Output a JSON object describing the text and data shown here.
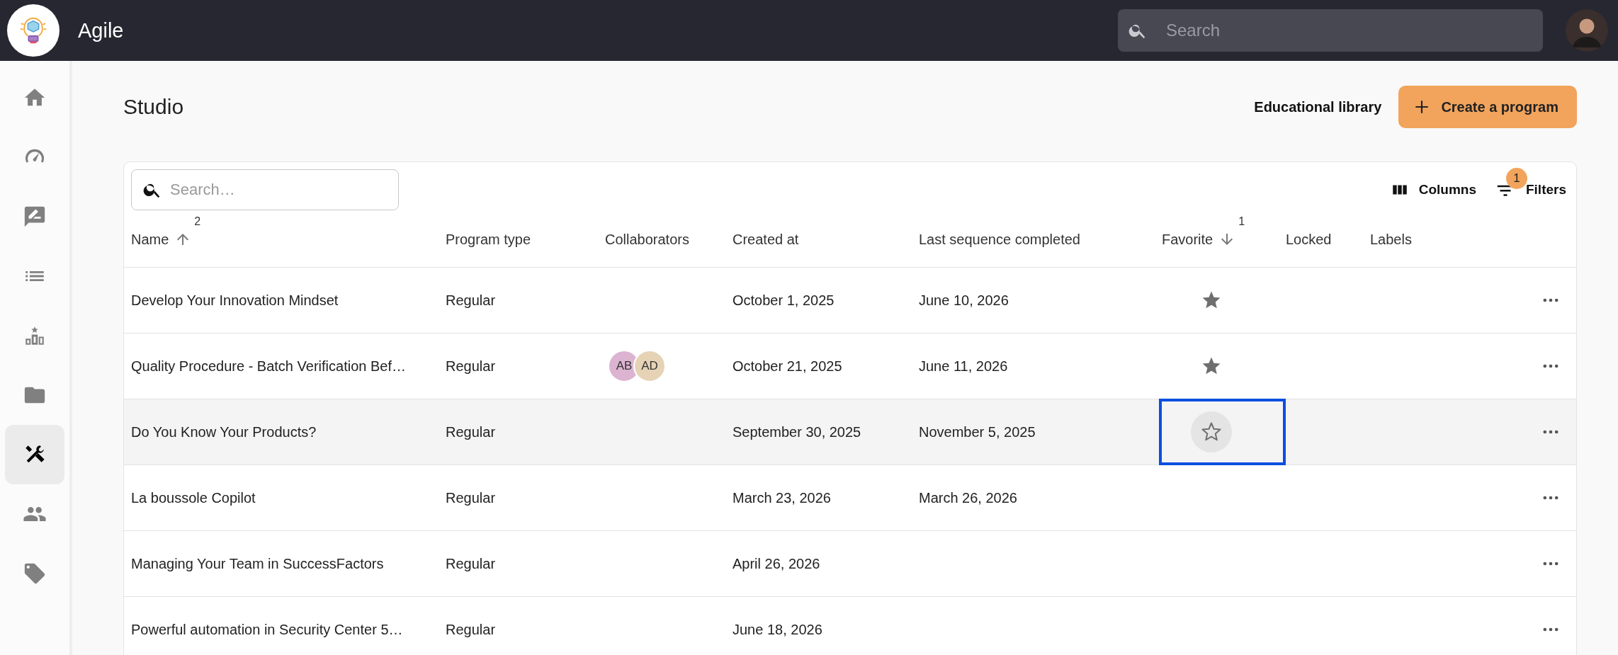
{
  "app": {
    "title": "Agile"
  },
  "top_search": {
    "placeholder": "Search"
  },
  "sidebar": {
    "items": [
      {
        "selected": false
      },
      {
        "selected": false
      },
      {
        "selected": false
      },
      {
        "selected": false
      },
      {
        "selected": false
      },
      {
        "selected": false
      },
      {
        "selected": true
      },
      {
        "selected": false
      },
      {
        "selected": false
      }
    ]
  },
  "page": {
    "title": "Studio",
    "library_link": "Educational library",
    "create_button": "Create a program"
  },
  "table_toolbar": {
    "search_placeholder": "Search…",
    "columns_button": "Columns",
    "filters_button": "Filters",
    "filters_count": "1"
  },
  "table": {
    "columns": [
      {
        "label": "Name",
        "kind": "ascending",
        "sort_rank": "2"
      },
      {
        "label": "Program type",
        "kind": "plain"
      },
      {
        "label": "Collaborators",
        "kind": "plain"
      },
      {
        "label": "Created at",
        "kind": "plain"
      },
      {
        "label": "Last sequence completed",
        "kind": "plain"
      },
      {
        "label": "Favorite",
        "kind": "descending",
        "sort_rank": "1"
      },
      {
        "label": "Locked",
        "kind": "plain"
      },
      {
        "label": "Labels",
        "kind": "plain"
      }
    ],
    "rows": [
      {
        "name": "Develop Your Innovation Mindset",
        "type": "Regular",
        "collaborators": [],
        "created": "October 1, 2025",
        "last_sequence": "June 10, 2026",
        "favorite": true,
        "hovered": false
      },
      {
        "name": "Quality Procedure - Batch Verification Bef…",
        "type": "Regular",
        "collaborators": [
          {
            "initials": "AB",
            "color": "#dcb4d2"
          },
          {
            "initials": "AD",
            "color": "#e6d3b6"
          }
        ],
        "created": "October 21, 2025",
        "last_sequence": "June 11, 2026",
        "favorite": true,
        "hovered": false
      },
      {
        "name": "Do You Know Your Products?",
        "type": "Regular",
        "collaborators": [],
        "created": "September 30, 2025",
        "last_sequence": "November 5, 2025",
        "favorite": false,
        "hovered": true
      },
      {
        "name": "La boussole Copilot",
        "type": "Regular",
        "collaborators": [],
        "created": "March 23, 2026",
        "last_sequence": "March 26, 2026",
        "favorite": false,
        "hovered": false
      },
      {
        "name": "Managing Your Team in SuccessFactors",
        "type": "Regular",
        "collaborators": [],
        "created": "April 26, 2026",
        "favorite": false,
        "hovered": false
      },
      {
        "name": "Powerful automation in Security Center 5…",
        "type": "Regular",
        "collaborators": [],
        "created": "June 18, 2026",
        "favorite": false,
        "hovered": false
      }
    ]
  }
}
